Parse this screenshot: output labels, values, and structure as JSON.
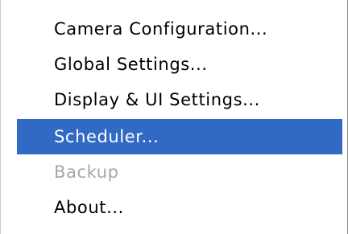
{
  "menu": {
    "items": [
      {
        "label": "Camera Configuration..."
      },
      {
        "label": "Global Settings..."
      },
      {
        "label": "Display & UI Settings..."
      },
      {
        "label": "Scheduler...",
        "state": "highlighted"
      },
      {
        "label": "Backup",
        "state": "disabled"
      },
      {
        "label": "About..."
      }
    ]
  },
  "colors": {
    "highlight_background": "#316ac5",
    "highlight_text": "#ffffff",
    "disabled_text": "#a7a6aa",
    "text": "#000000",
    "background": "#ffffff"
  }
}
